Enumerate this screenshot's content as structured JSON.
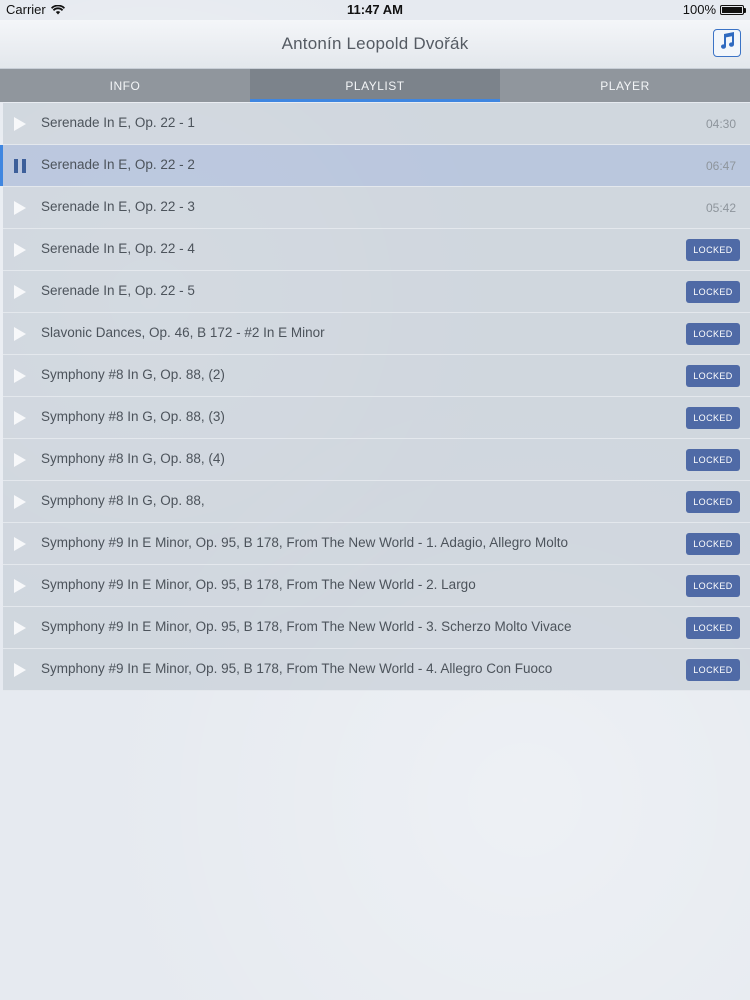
{
  "status_bar": {
    "carrier": "Carrier",
    "time": "11:47 AM",
    "battery": "100%",
    "battery_level": 1.0,
    "icons": [
      "wifi-icon",
      "battery-icon"
    ]
  },
  "header": {
    "title": "Antonín Leopold Dvořák",
    "music_button_icon": "music-note-icon",
    "accent_color": "#3f86e0"
  },
  "tabs": [
    {
      "label": "INFO",
      "active": false
    },
    {
      "label": "PLAYLIST",
      "active": true
    },
    {
      "label": "PLAYER",
      "active": false
    }
  ],
  "playlist": {
    "locked_label": "LOCKED",
    "badge_color": "#4f6aa6",
    "tracks": [
      {
        "title": "Serenade In E, Op. 22 - 1",
        "duration": "04:30",
        "locked": false,
        "state": "play"
      },
      {
        "title": "Serenade In E, Op. 22 - 2",
        "duration": "06:47",
        "locked": false,
        "state": "pause"
      },
      {
        "title": "Serenade In E, Op. 22 - 3",
        "duration": "05:42",
        "locked": false,
        "state": "play"
      },
      {
        "title": "Serenade In E, Op. 22 - 4",
        "duration": "",
        "locked": true,
        "state": "play"
      },
      {
        "title": "Serenade In E, Op. 22 - 5",
        "duration": "",
        "locked": true,
        "state": "play"
      },
      {
        "title": "Slavonic Dances, Op. 46, B 172 - #2 In E Minor",
        "duration": "",
        "locked": true,
        "state": "play"
      },
      {
        "title": "Symphony #8 In G, Op. 88, (2)",
        "duration": "",
        "locked": true,
        "state": "play"
      },
      {
        "title": "Symphony #8 In G, Op. 88, (3)",
        "duration": "",
        "locked": true,
        "state": "play"
      },
      {
        "title": "Symphony #8 In G, Op. 88, (4)",
        "duration": "",
        "locked": true,
        "state": "play"
      },
      {
        "title": "Symphony #8 In G, Op. 88,",
        "duration": "",
        "locked": true,
        "state": "play"
      },
      {
        "title": "Symphony #9 In E Minor, Op. 95, B 178, From The New World - 1. Adagio, Allegro Molto",
        "duration": "",
        "locked": true,
        "state": "play"
      },
      {
        "title": "Symphony #9 In E Minor, Op. 95, B 178, From The New World - 2. Largo",
        "duration": "",
        "locked": true,
        "state": "play"
      },
      {
        "title": "Symphony #9 In E Minor, Op. 95, B 178, From The New World - 3. Scherzo Molto Vivace",
        "duration": "",
        "locked": true,
        "state": "play"
      },
      {
        "title": "Symphony #9 In E Minor, Op. 95, B 178, From The New World - 4. Allegro Con Fuoco",
        "duration": "",
        "locked": true,
        "state": "play"
      }
    ]
  }
}
